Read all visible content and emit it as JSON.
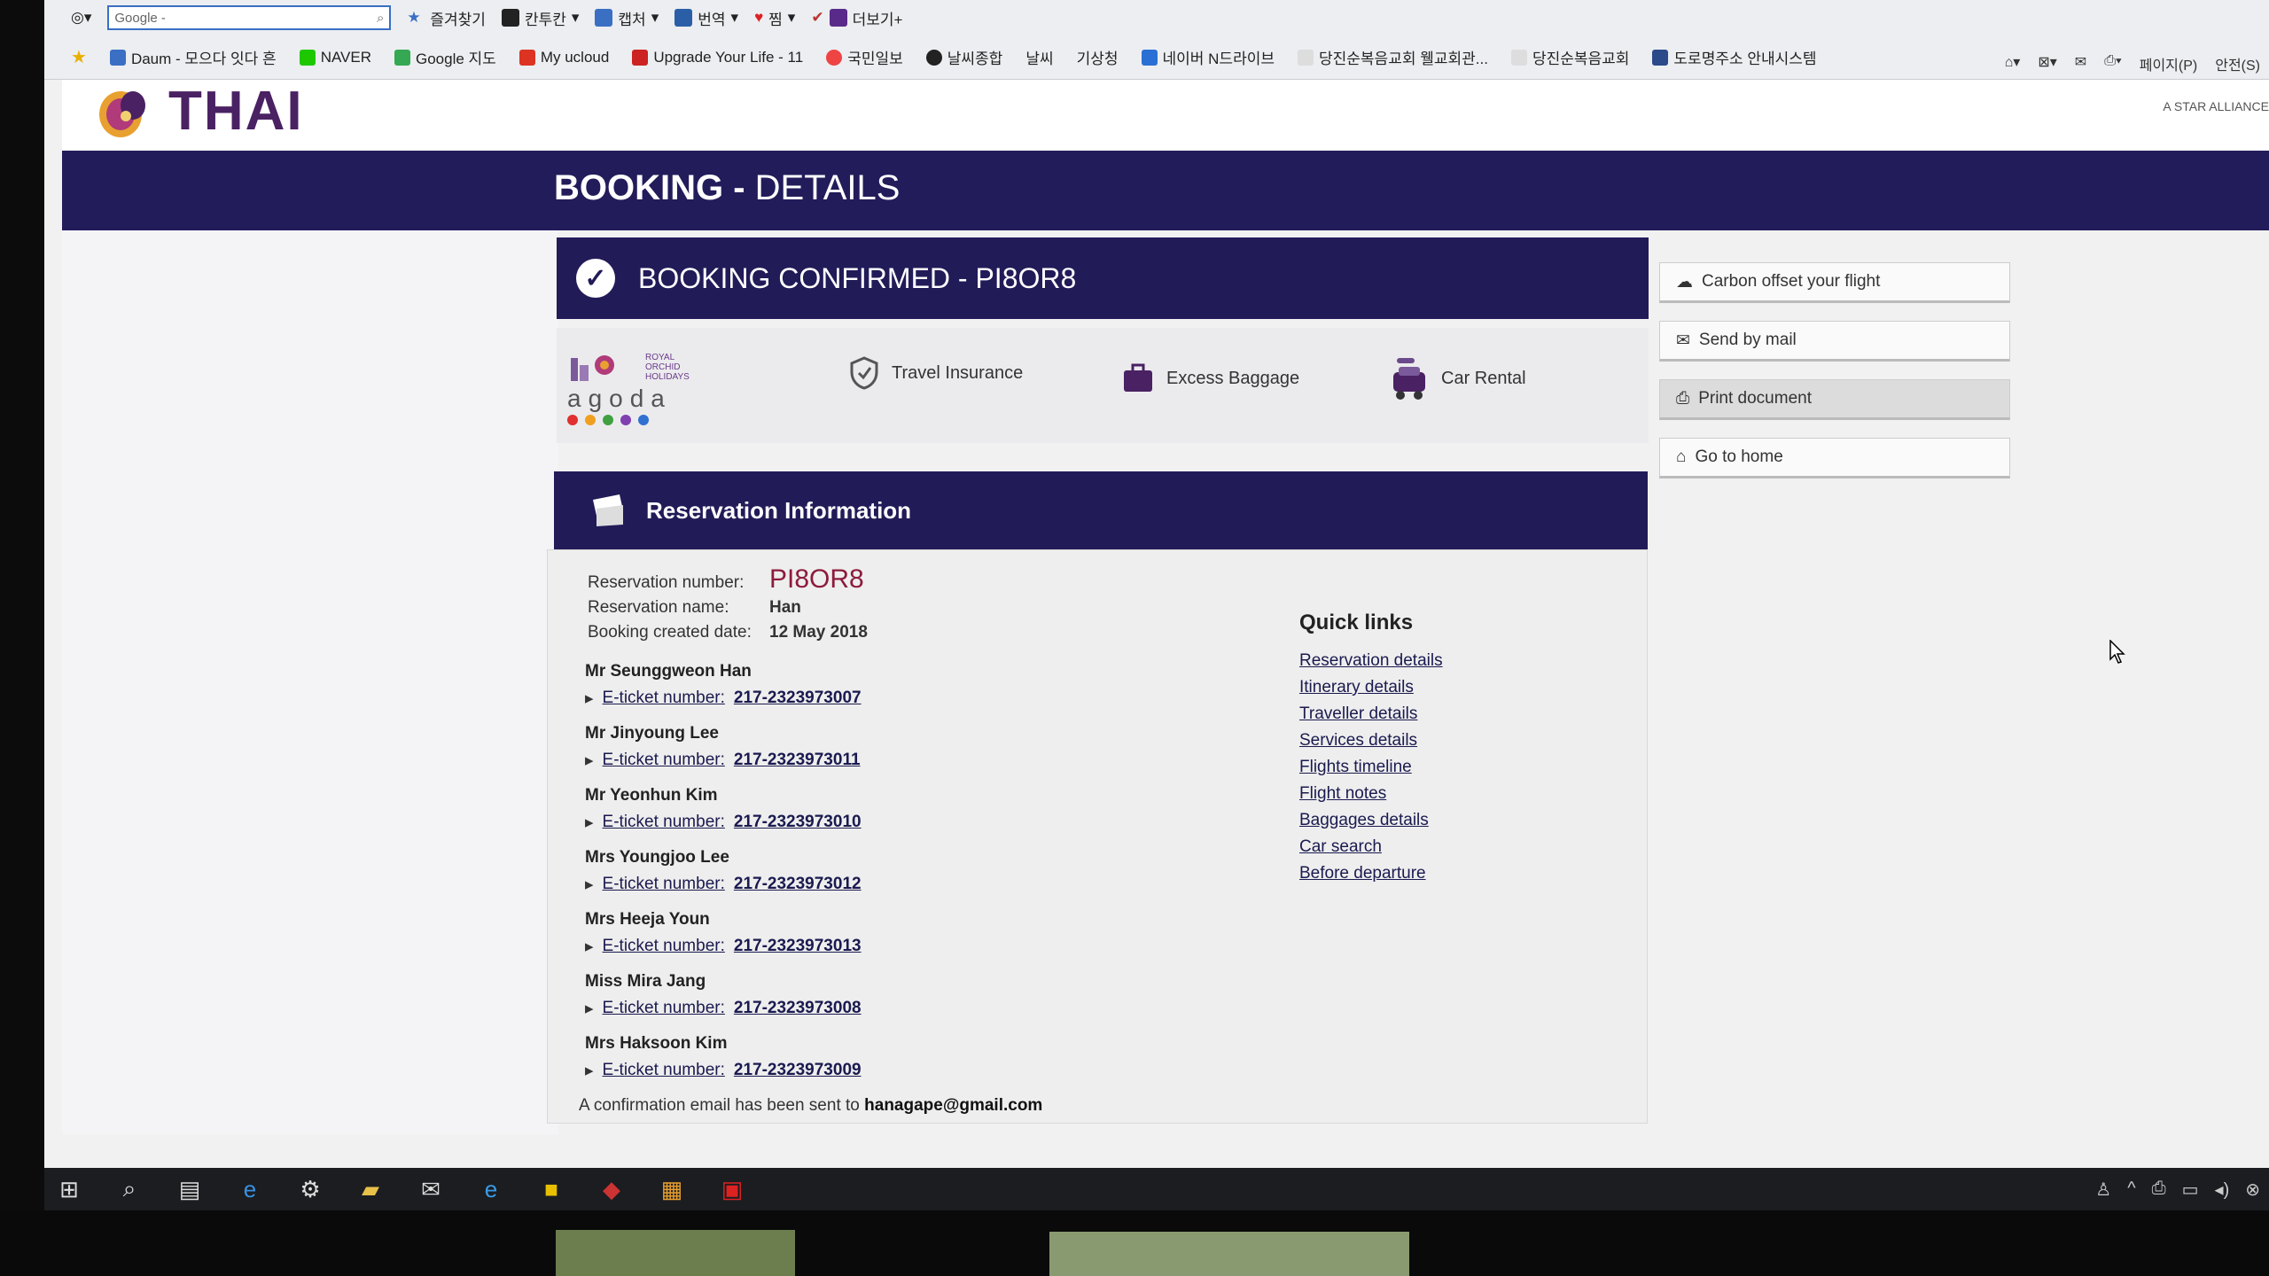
{
  "browser": {
    "search_placeholder": "Google -",
    "toolbar_items": [
      "즐겨찾기",
      "칸투칸",
      "캡처",
      "번역",
      "찜",
      "더보기+"
    ],
    "favorites": [
      "Daum - 모으다 잇다 흔",
      "NAVER",
      "Google 지도",
      "My ucloud",
      "Upgrade Your Life - 11",
      "국민일보",
      "날씨종합",
      "날씨",
      "기상청",
      "네이버 N드라이브",
      "당진순복음교회 웰교회관...",
      "당진순복음교회",
      "도로명주소 안내시스템"
    ],
    "right_menu": [
      "페이지(P)",
      "안전(S)"
    ]
  },
  "site": {
    "logo_text": "THAI",
    "alliance": "A STAR ALLIANCE",
    "title_bold": "BOOKING -",
    "title_rest": " DETAILS"
  },
  "confirmed": {
    "text": "BOOKING CONFIRMED - PI8OR8"
  },
  "partners": {
    "agoda": "agoda",
    "royal": "ROYAL ORCHID HOLIDAYS",
    "items": [
      "Travel Insurance",
      "Excess Baggage",
      "Car Rental"
    ]
  },
  "reservation": {
    "header": "Reservation Information",
    "number_label": "Reservation number:",
    "number": "PI8OR8",
    "name_label": "Reservation name:",
    "name": "Han",
    "date_label": "Booking created date:",
    "date": "12 May 2018",
    "ticket_label": "E-ticket number:",
    "passengers": [
      {
        "name": "Mr Seunggweon Han",
        "ticket": "217-2323973007"
      },
      {
        "name": "Mr Jinyoung Lee",
        "ticket": "217-2323973011"
      },
      {
        "name": "Mr Yeonhun Kim",
        "ticket": "217-2323973010"
      },
      {
        "name": "Mrs Youngjoo Lee",
        "ticket": "217-2323973012"
      },
      {
        "name": "Mrs Heeja Youn",
        "ticket": "217-2323973013"
      },
      {
        "name": "Miss Mira Jang",
        "ticket": "217-2323973008"
      },
      {
        "name": "Mrs Haksoon Kim",
        "ticket": "217-2323973009"
      }
    ],
    "email_text": "A confirmation email has been sent to",
    "email": "hanagape@gmail.com"
  },
  "quick_links": {
    "title": "Quick links",
    "items": [
      "Reservation details",
      "Itinerary details",
      "Traveller details",
      "Services details",
      "Flights timeline",
      "Flight notes",
      "Baggages details",
      "Car search",
      "Before departure"
    ]
  },
  "actions": [
    "Carbon offset your flight",
    "Send by mail",
    "Print document",
    "Go to home"
  ],
  "colors": {
    "navy": "#221c5b",
    "pnr": "#8c1c3d",
    "thai_purple": "#4a2163"
  }
}
